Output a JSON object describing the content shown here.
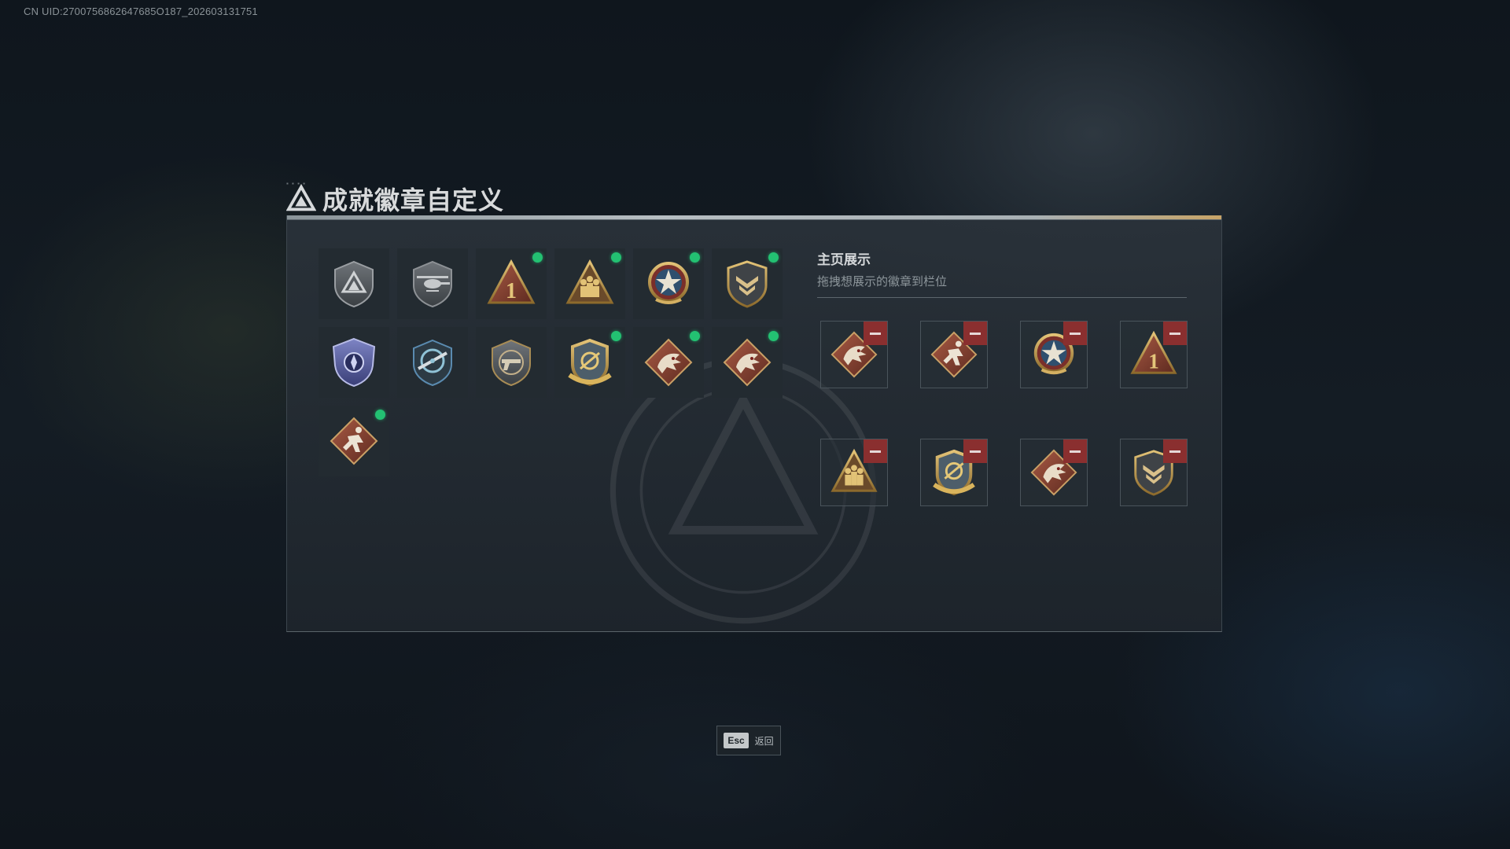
{
  "uid_text": "CN UID:2700756862647685O187_202603131751",
  "page": {
    "title": "成就徽章自定义"
  },
  "badge_grid": [
    {
      "icon": "triangle-shield-badge-icon",
      "new": false
    },
    {
      "icon": "helicopter-badge-icon",
      "new": false
    },
    {
      "icon": "number-one-badge-icon",
      "new": true
    },
    {
      "icon": "soldiers-badge-icon",
      "new": true
    },
    {
      "icon": "star-medal-badge-icon",
      "new": true
    },
    {
      "icon": "chevron-shield-badge-icon",
      "new": true
    },
    {
      "icon": "blue-shield-badge-icon",
      "new": false
    },
    {
      "icon": "target-rifle-badge-icon",
      "new": false
    },
    {
      "icon": "pistol-shield-badge-icon",
      "new": false
    },
    {
      "icon": "gold-crest-badge-icon",
      "new": true
    },
    {
      "icon": "dragon-badge-icon",
      "new": true
    },
    {
      "icon": "dragon-badge-icon",
      "new": true
    },
    {
      "icon": "runner-badge-icon",
      "new": true
    }
  ],
  "showcase": {
    "title": "主页展示",
    "subtitle": "拖拽想展示的徽章到栏位",
    "slots": [
      {
        "icon": "dragon-badge-icon"
      },
      {
        "icon": "runner-badge-icon"
      },
      {
        "icon": "star-medal-badge-icon"
      },
      {
        "icon": "number-one-badge-icon"
      },
      {
        "icon": "soldiers-badge-icon"
      },
      {
        "icon": "gold-crest-badge-icon"
      },
      {
        "icon": "dragon-badge-icon"
      },
      {
        "icon": "chevron-shield-badge-icon"
      }
    ]
  },
  "footer": {
    "esc_key": "Esc",
    "esc_label": "返回"
  },
  "colors": {
    "new_dot": "#23c172",
    "remove": "#8a2f2f",
    "gold": "#c9a24a",
    "red": "#8d3a2c"
  }
}
